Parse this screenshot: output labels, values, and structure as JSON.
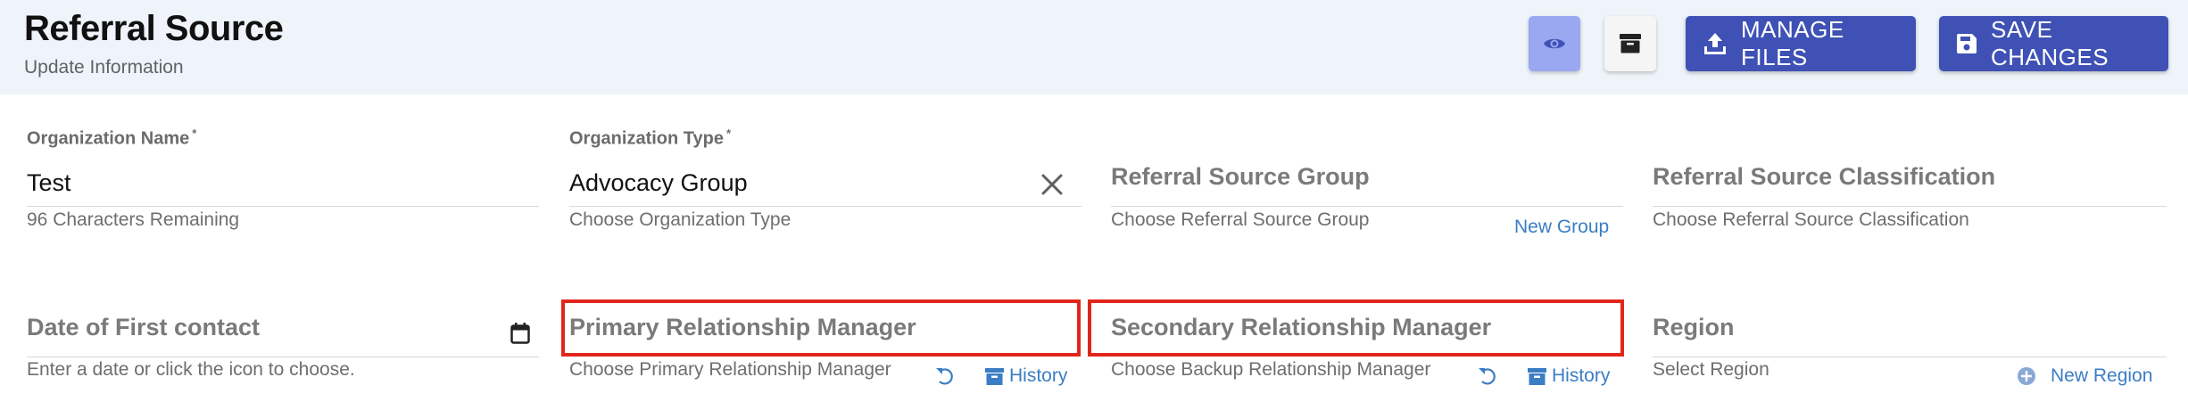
{
  "header": {
    "title": "Referral Source",
    "subtitle": "Update Information",
    "view_icon": "eye-icon",
    "archive_icon": "archive-box-icon",
    "manage_files_label": "MANAGE FILES",
    "manage_files_icon": "upload-icon",
    "save_changes_label": "SAVE CHANGES",
    "save_changes_icon": "floppy-disk-icon",
    "colors": {
      "header_bg": "#eef4f9",
      "primary": "#3f51b5",
      "view_button": "#9aa7f1"
    }
  },
  "form": {
    "organization_name": {
      "label": "Organization Name",
      "required_mark": "*",
      "value": "Test",
      "helper": "96 Characters Remaining"
    },
    "organization_type": {
      "label": "Organization Type",
      "required_mark": "*",
      "value": "Advocacy Group",
      "helper": "Choose Organization Type",
      "clear_icon": "close-icon"
    },
    "referral_source_group": {
      "label": "Referral Source Group",
      "helper": "Choose Referral Source Group",
      "link": "New Group"
    },
    "referral_source_classification": {
      "label": "Referral Source Classification",
      "helper": "Choose Referral Source Classification"
    },
    "date_of_first_contact": {
      "label": "Date of First contact",
      "helper": "Enter a date or click the icon to choose.",
      "icon": "calendar-icon"
    },
    "primary_relationship_manager": {
      "label": "Primary Relationship Manager",
      "helper": "Choose Primary Relationship Manager",
      "undo_icon": "undo-icon",
      "history_label": "History",
      "history_icon": "archive-icon"
    },
    "secondary_relationship_manager": {
      "label": "Secondary Relationship Manager",
      "helper": "Choose Backup Relationship Manager",
      "undo_icon": "undo-icon",
      "history_label": "History",
      "history_icon": "archive-icon"
    },
    "region": {
      "label": "Region",
      "helper": "Select Region",
      "link": "New Region",
      "link_icon": "plus-circle-icon"
    }
  },
  "highlight_color": "#e0261b"
}
